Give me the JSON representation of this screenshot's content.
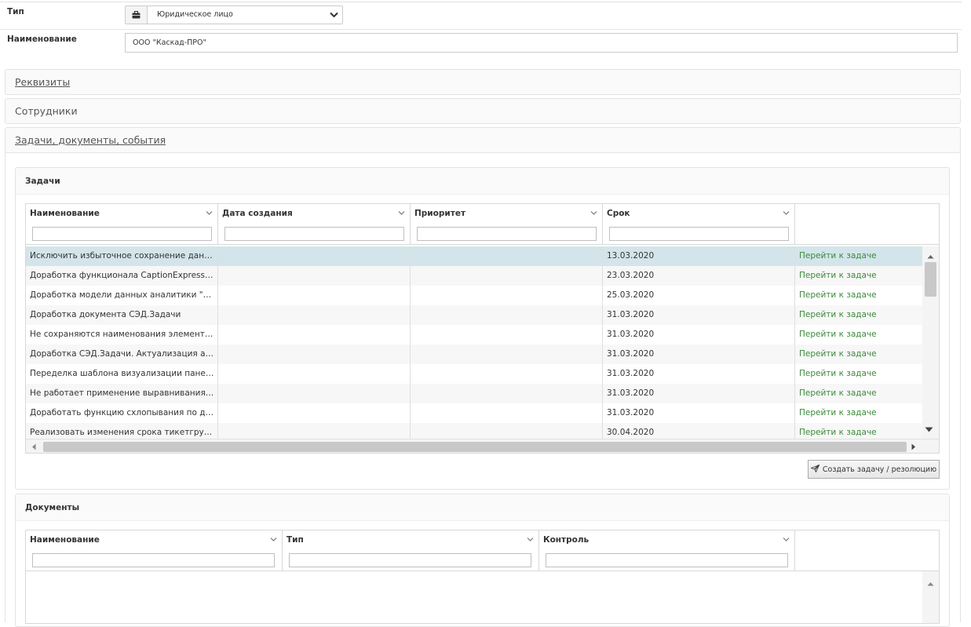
{
  "form": {
    "type_label": "Тип",
    "type_value": "Юридическое лицо",
    "name_label": "Наименование",
    "name_value": "ООО \"Каскад-ПРО\""
  },
  "sections": {
    "requisites": "Реквизиты",
    "employees": "Сотрудники",
    "tasks_docs_events": "Задачи, документы, события"
  },
  "tasks_panel": {
    "title": "Задачи",
    "columns": [
      "Наименование",
      "Дата создания",
      "Приоритет",
      "Срок"
    ],
    "rows": [
      {
        "name": "Исключить избыточное сохранение дан…",
        "created": "",
        "priority": "",
        "due": "13.03.2020",
        "action": "Перейти к задаче"
      },
      {
        "name": "Доработка функционала CaptionExpress…",
        "created": "",
        "priority": "",
        "due": "23.03.2020",
        "action": "Перейти к задаче"
      },
      {
        "name": "Доработка модели данных аналитики \"…",
        "created": "",
        "priority": "",
        "due": "25.03.2020",
        "action": "Перейти к задаче"
      },
      {
        "name": "Доработка документа СЭД.Задачи",
        "created": "",
        "priority": "",
        "due": "31.03.2020",
        "action": "Перейти к задаче"
      },
      {
        "name": "Не сохраняются наименования элемент…",
        "created": "",
        "priority": "",
        "due": "31.03.2020",
        "action": "Перейти к задаче"
      },
      {
        "name": "Доработка СЭД.Задачи. Актуализация а…",
        "created": "",
        "priority": "",
        "due": "31.03.2020",
        "action": "Перейти к задаче"
      },
      {
        "name": "Переделка шаблона визуализации пане…",
        "created": "",
        "priority": "",
        "due": "31.03.2020",
        "action": "Перейти к задаче"
      },
      {
        "name": "Не работает применение выравнивания…",
        "created": "",
        "priority": "",
        "due": "31.03.2020",
        "action": "Перейти к задаче"
      },
      {
        "name": "Доработать функцию схлопывания по д…",
        "created": "",
        "priority": "",
        "due": "31.03.2020",
        "action": "Перейти к задаче"
      },
      {
        "name": "Реализовать изменения срока тикетгру…",
        "created": "",
        "priority": "",
        "due": "30.04.2020",
        "action": "Перейти к задаче"
      }
    ],
    "create_button": "Создать задачу / резолюцию"
  },
  "documents_panel": {
    "title": "Документы",
    "columns": [
      "Наименование",
      "Тип",
      "Контроль"
    ]
  },
  "colors": {
    "link_green": "#3b8a3b",
    "selected_row": "#d3e5ea"
  },
  "icons": {
    "type_select": "briefcase-icon",
    "dropdown": "chevron-down-icon",
    "create_button": "paper-plane-icon"
  }
}
